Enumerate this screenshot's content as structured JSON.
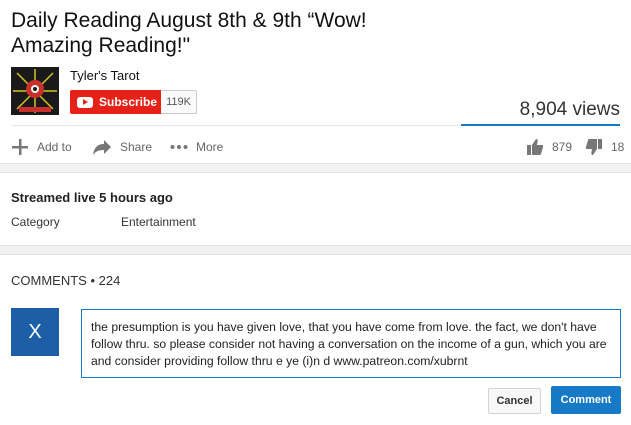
{
  "video": {
    "title": "Daily Reading August 8th & 9th “Wow! Amazing Reading!\"",
    "views": "8,904 views"
  },
  "channel": {
    "name": "Tyler's Tarot",
    "subscribe_label": "Subscribe",
    "subscriber_count": "119K"
  },
  "actions": {
    "add_to": "Add to",
    "share": "Share",
    "more": "More",
    "likes": "879",
    "dislikes": "18"
  },
  "info": {
    "streamed": "Streamed live 5 hours ago",
    "category_label": "Category",
    "category_value": "Entertainment"
  },
  "comments": {
    "header": "COMMENTS • 224",
    "user_initial": "X",
    "draft": "the presumption is you have given love, that you have come from love. the fact, we don't have follow thru. so please consider not having a conversation on the income of a gun, which you are and consider providing follow thru e ye (i)n d  www.patreon.com/xubrnt",
    "cancel_label": "Cancel",
    "comment_label": "Comment"
  },
  "colors": {
    "subscribe_red": "#e62117",
    "accent_blue": "#167ac6",
    "avatar_blue": "#1c5fa6"
  },
  "icons": [
    "add-icon",
    "share-icon",
    "more-icon",
    "like-icon",
    "dislike-icon",
    "youtube-play-icon"
  ]
}
